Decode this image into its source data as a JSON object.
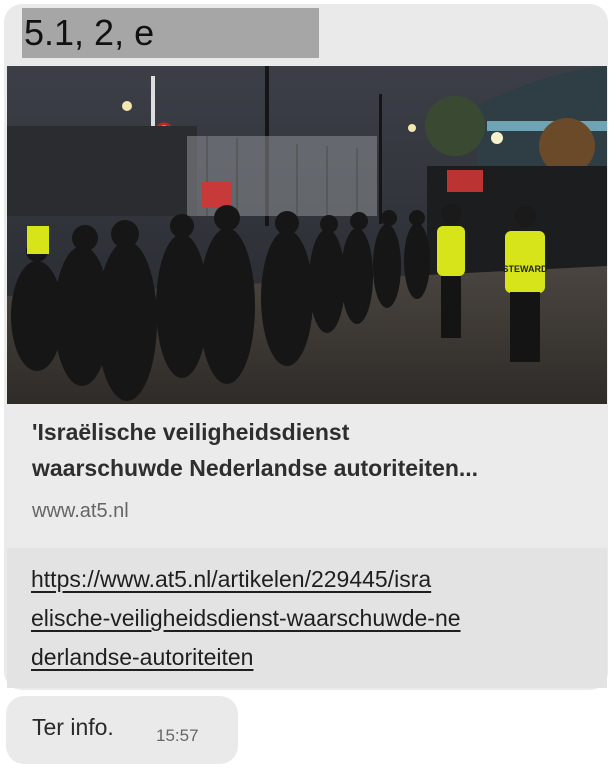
{
  "redaction_label": "5.1, 2, e",
  "link_preview": {
    "title_line1": "'Israëlische veiligheidsdienst",
    "title_line2": "waarschuwde Nederlandse autoriteiten...",
    "domain": "www.at5.nl",
    "image_sign_text": "STEWARD"
  },
  "link": {
    "line1": "https://www.at5.nl/artikelen/229445/isra",
    "line2": "elische-veiligheidsdienst-waarschuwde-ne",
    "line3": "derlandse-autoriteiten"
  },
  "message": {
    "text": "Ter info.",
    "time": "15:57"
  },
  "colors": {
    "bubble": "#eaeaea",
    "link_bg": "#e3e3e3",
    "redaction": "#a6a6a6",
    "steward_vest": "#d8e41a"
  }
}
